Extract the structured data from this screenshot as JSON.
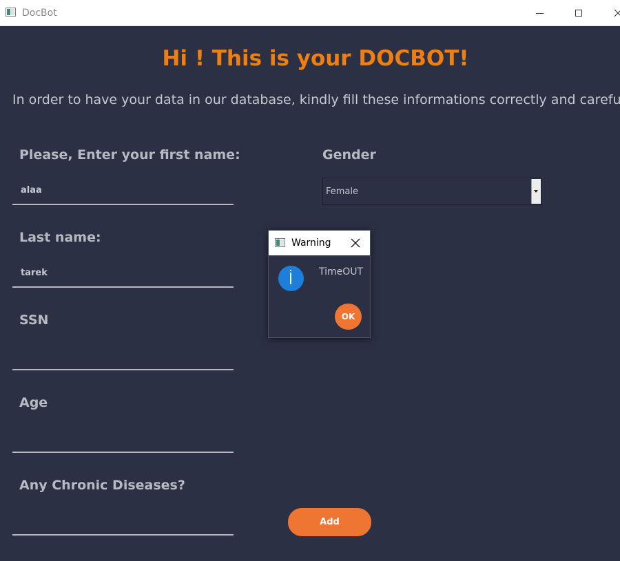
{
  "window": {
    "title": "DocBot",
    "icon": "app-window-icon"
  },
  "page": {
    "heading": "Hi ! This is your DOCBOT!",
    "intro": "In order to have your data in our database, kindly fill these informations correctly and careful"
  },
  "form": {
    "first_name_label": "Please, Enter your first name:",
    "first_name_value": "alaa",
    "last_name_label": "Last name:",
    "last_name_value": "tarek",
    "ssn_label": "SSN",
    "ssn_value": "",
    "age_label": "Age",
    "age_value": "",
    "chronic_label": "Any Chronic Diseases?",
    "chronic_value": "",
    "gender_label": "Gender",
    "gender_value": "Female",
    "add_label": "Add"
  },
  "dialog": {
    "title": "Warning",
    "message": "TimeOUT",
    "ok_label": "OK",
    "icon": "info-icon"
  },
  "colors": {
    "background": "#2b3044",
    "accent": "#ef7532",
    "heading": "#f07f12",
    "info": "#1d7fdc"
  }
}
